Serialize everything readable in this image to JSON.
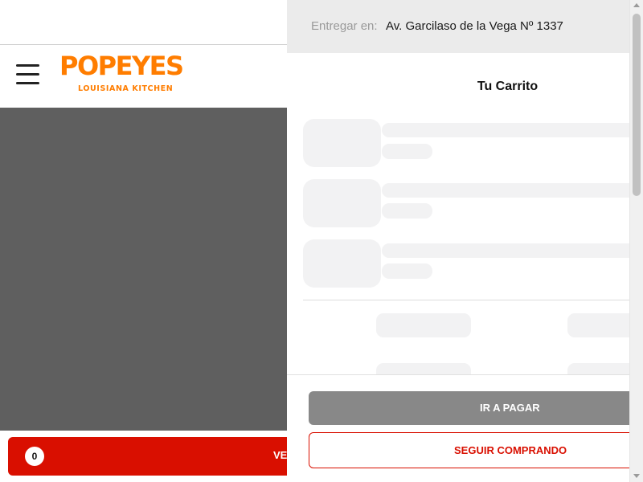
{
  "brand": {
    "name": "POPEYES",
    "tagline": "LOUISIANA KITCHEN",
    "accent_color": "#ff7d00",
    "primary_red": "#d90f00"
  },
  "header": {
    "menu_icon": "hamburger-menu-icon"
  },
  "cart_bar": {
    "count": "0",
    "label": "VE"
  },
  "drawer": {
    "delivery_label": "Entregar en:",
    "delivery_address": "Av. Garcilaso de la Vega Nº 1337",
    "title": "Tu Carrito",
    "loading": true,
    "pay_button_label": "IR A PAGAR",
    "continue_button_label": "SEGUIR COMPRANDO"
  }
}
